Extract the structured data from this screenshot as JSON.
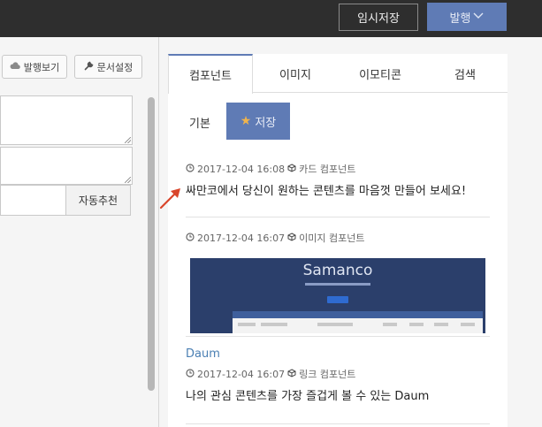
{
  "topbar": {
    "draft_label": "임시저장",
    "publish_label": "발행"
  },
  "editor": {
    "preview_label": "발행보기",
    "settings_label": "문서설정",
    "auto_tag_label": "자동추천"
  },
  "tabs": [
    {
      "label": "컴포넌트",
      "active": true
    },
    {
      "label": "이미지",
      "active": false
    },
    {
      "label": "이모티콘",
      "active": false
    },
    {
      "label": "검색",
      "active": false
    }
  ],
  "subtabs": {
    "basic_label": "기본",
    "saved_label": "저장"
  },
  "items": [
    {
      "time": "2017-12-04 16:08",
      "type": "카드 컴포넌트",
      "text": "싸만코에서 당신이 원하는 콘텐츠를 마음껏 만들어 보세요!"
    },
    {
      "time": "2017-12-04 16:07",
      "type": "이미지 컴포넌트",
      "thumb_logo": "Samanco"
    },
    {
      "title": "Daum",
      "time": "2017-12-04 16:07",
      "type": "링크 컴포넌트",
      "text": "나의 관심 콘텐츠를 가장 즐겁게 볼 수 있는 Daum"
    }
  ],
  "colors": {
    "accent": "#5f7bb5",
    "star": "#f0b44c",
    "link": "#4a7fb3",
    "topbar": "#2e2e2e",
    "arrow": "#d9452b"
  }
}
